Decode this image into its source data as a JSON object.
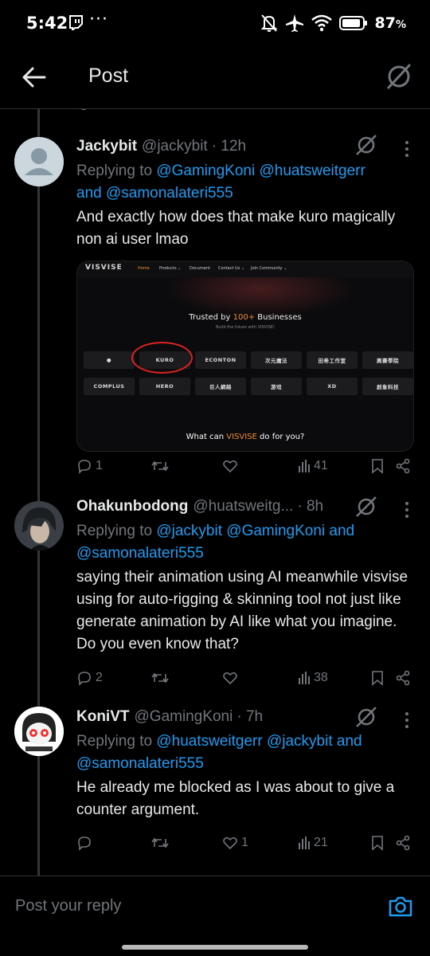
{
  "status_bar": {
    "time": "5:42",
    "more": "···",
    "battery": "87",
    "battery_unit": "%",
    "icons": [
      "twitch-icon",
      "mute-icon",
      "airplane-icon",
      "wifi-icon",
      "battery-icon"
    ]
  },
  "header": {
    "title": "Post",
    "icons": [
      "back-arrow-icon",
      "grok-icon"
    ]
  },
  "posts": [
    {
      "name": "Jackybit",
      "handle": "@jackybit",
      "time": "· 12h",
      "replying_prefix": "Replying to ",
      "mentions": [
        "@GamingKoni",
        "@huatsweitgerr",
        "@samonalateri555"
      ],
      "and": "and",
      "text": "And exactly how does that make kuro magically non ai user lmao",
      "media": {
        "logo": "VISVISE",
        "nav": [
          "Home",
          "Products ⌄",
          "Document",
          "Contact Us ⌄",
          "Join Community ⌄"
        ],
        "trusted_pre": "Trusted by ",
        "trusted_num": "100+",
        "trusted_post": " Businesses",
        "trusted_sub": "Build the future with VISVISE!",
        "row1": [
          "●",
          "KURO",
          "ECONTON",
          "次元魔法",
          "田希工作室",
          "興賽學院"
        ],
        "row2": [
          "COMPLUS",
          "HERO",
          "巨人網絡",
          "游戏",
          "XD",
          "創象科技"
        ],
        "what_pre": "What can ",
        "what_brand": "VISVISE",
        "what_post": " do for you?"
      },
      "stats": {
        "replies": "1",
        "reposts": "",
        "likes": "",
        "views": "41"
      }
    },
    {
      "name": "Ohakunbodong",
      "handle": "@huatsweitg...",
      "time": "· 8h",
      "replying_prefix": "Replying to ",
      "mentions": [
        "@jackybit",
        "@GamingKoni",
        "@samonalateri555"
      ],
      "and": "and",
      "text": "saying their animation using AI meanwhile visvise using for auto-rigging & skinning tool not just like generate animation by AI like what you imagine. Do you even know that?",
      "stats": {
        "replies": "2",
        "reposts": "",
        "likes": "",
        "views": "38"
      }
    },
    {
      "name": "KoniVT",
      "handle": "@GamingKoni",
      "time": "· 7h",
      "replying_prefix": "Replying to ",
      "mentions": [
        "@huatsweitgerr",
        "@jackybit",
        "@samonalateri555"
      ],
      "and": "and",
      "text": "He already me blocked as I was about to give a counter argument.",
      "stats": {
        "replies": "",
        "reposts": "",
        "likes": "1",
        "views": "21"
      }
    }
  ],
  "reply_box": {
    "placeholder": "Post your reply",
    "icons": [
      "camera-icon"
    ]
  },
  "colors": {
    "background": "#000000",
    "text": "#e7e9ea",
    "muted": "#71767b",
    "link": "#1d9bf0",
    "divider": "#2f3336"
  }
}
